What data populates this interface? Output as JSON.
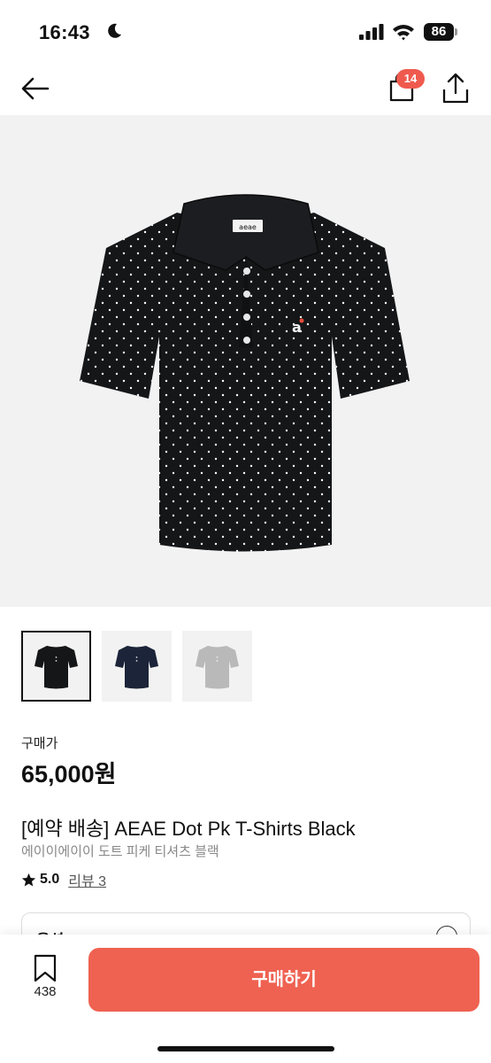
{
  "status": {
    "time": "16:43",
    "battery": "86"
  },
  "nav": {
    "bag_count": "14"
  },
  "colors": {
    "accent": "#ef6251",
    "badge": "#ef5a4e",
    "shirt_black": "#151618",
    "shirt_navy": "#1b2438",
    "shirt_gray": "#b9b9b9"
  },
  "icons": [
    "moon-icon",
    "signal-icon",
    "wifi-icon",
    "battery-icon",
    "back-arrow-icon",
    "shopping-bag-icon",
    "share-icon",
    "star-icon",
    "bookmark-icon"
  ],
  "gallery": {
    "selected_index": 0,
    "thumbnails": [
      "black",
      "navy",
      "gray"
    ]
  },
  "product": {
    "price_label": "구매가",
    "price": "65,000원",
    "title": "[예약 배송] AEAE Dot Pk T-Shirts Black",
    "subtitle": "에이이에이이 도트 피케 티셔츠 블랙",
    "rating": "5.0",
    "review_label": "리뷰 3"
  },
  "options": {
    "label": "옵션"
  },
  "bottom": {
    "wish_count": "438",
    "buy_label": "구매하기"
  }
}
